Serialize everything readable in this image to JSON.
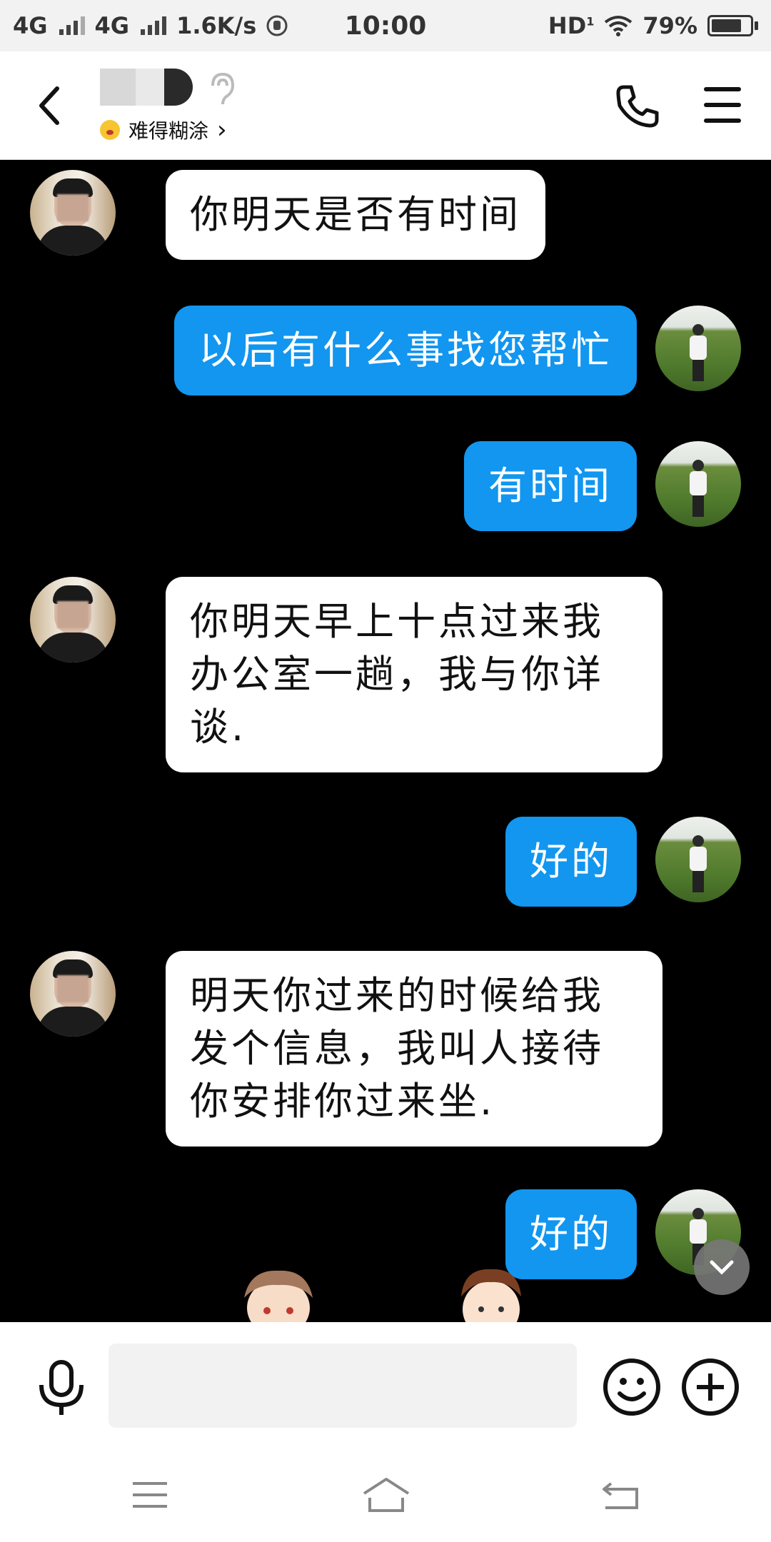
{
  "status_bar": {
    "network1": "4G",
    "network2": "4G",
    "speed": "1.6K/s",
    "time": "10:00",
    "hd": "HD",
    "battery": "79%",
    "battery_level": 0.79
  },
  "header": {
    "subtitle": "难得糊涂",
    "subtitle_arrow": "›"
  },
  "messages": [
    {
      "side": "left",
      "text": "你明天是否有时间"
    },
    {
      "side": "right",
      "text": "以后有什么事找您帮忙"
    },
    {
      "side": "right",
      "text": "有时间"
    },
    {
      "side": "left",
      "lines": [
        "你明天早上十点过来我",
        "办公室一趟，我与你详",
        "谈."
      ]
    },
    {
      "side": "right",
      "text": "好的"
    },
    {
      "side": "left",
      "lines": [
        "明天你过来的时候给我",
        "发个信息，我叫人接待",
        "你安排你过来坐."
      ]
    },
    {
      "side": "right",
      "text": "好的"
    }
  ],
  "icons": {
    "back": "back-arrow-icon",
    "phone": "phone-icon",
    "menu": "menu-icon",
    "mic": "microphone-icon",
    "emoji": "emoji-icon",
    "plus": "plus-icon",
    "scroll": "chevron-down-icon"
  },
  "colors": {
    "chat_bg": "#000000",
    "bubble_sent": "#1296f0",
    "bubble_received": "#ffffff"
  }
}
